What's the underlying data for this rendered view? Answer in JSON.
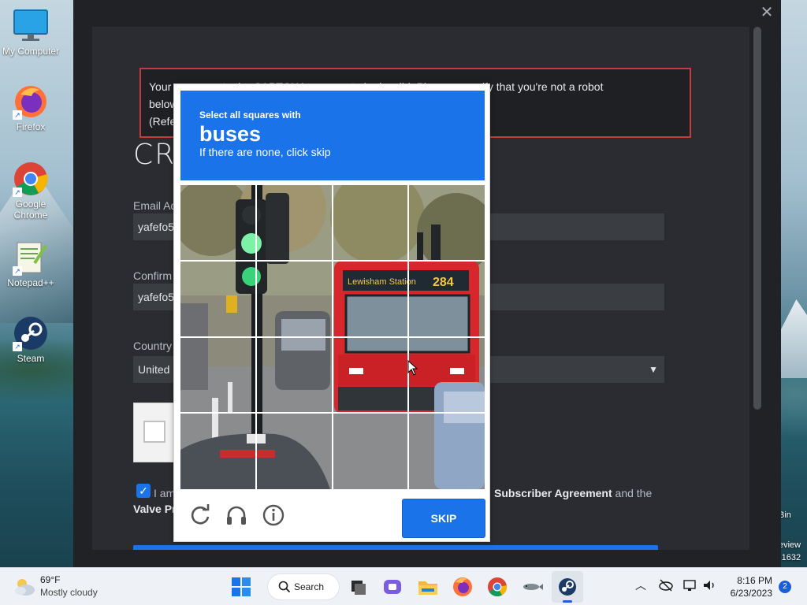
{
  "desktop": {
    "icons": [
      {
        "label": "My Computer",
        "icon": "monitor-icon"
      },
      {
        "label": "Firefox",
        "icon": "firefox-icon"
      },
      {
        "label": "Google Chrome",
        "icon": "chrome-icon"
      },
      {
        "label": "Notepad++",
        "icon": "notepadpp-icon"
      },
      {
        "label": "Steam",
        "icon": "steam-icon"
      }
    ],
    "right_edge": {
      "line1": "Bin",
      "line2": "eview",
      "line3": "-1632"
    }
  },
  "signup": {
    "error": {
      "line1": "Your response to the CAPTCHA appears to be invalid. Please re-verify that you're not a robot",
      "line2": "below.",
      "line3": "(Referer"
    },
    "title": "CR",
    "email_label": "Email Ad",
    "email_value": "yafefo5",
    "confirm_label": "Confirm",
    "confirm_value": "yafefo5",
    "country_label": "Country",
    "country_value": "United",
    "agree_prefix": "I am",
    "agree_link1": "Subscriber Agreement",
    "agree_middle": " and the",
    "agree_link2": "Valve Pr"
  },
  "captcha": {
    "instruction": "Select all squares with",
    "target": "buses",
    "hint": "If there are none, click skip",
    "skip_label": "SKIP",
    "tiles": 16,
    "bus_sign": "Lewisham Station",
    "bus_route": "284"
  },
  "taskbar": {
    "weather_temp": "69°F",
    "weather_desc": "Mostly cloudy",
    "search_label": "Search",
    "time": "8:16 PM",
    "date": "6/23/2023",
    "notifications": "2"
  }
}
